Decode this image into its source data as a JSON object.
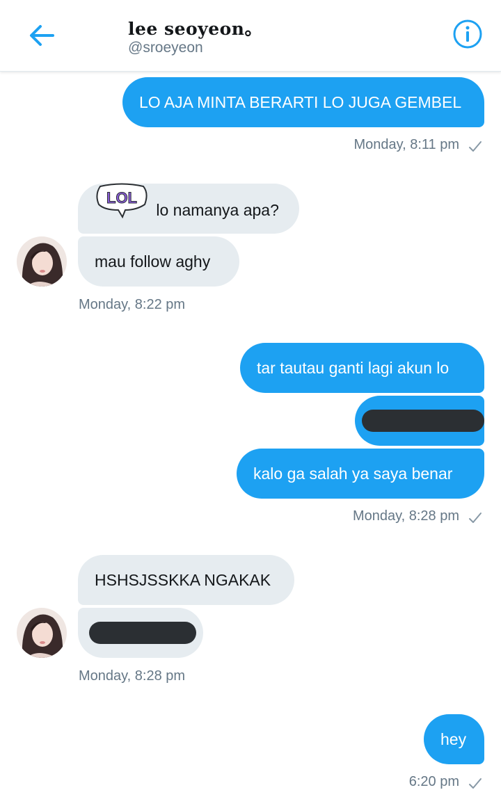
{
  "header": {
    "title": "lee seoyeon。",
    "handle": "@sroeyeon"
  },
  "icons": {
    "back": "arrow-left-icon",
    "info": "info-circle-icon",
    "check": "checkmark-icon",
    "sticker": "lol-sticker-icon"
  },
  "colors": {
    "accent": "#1da1f2",
    "incoming_bubble": "#e6ecf0",
    "meta_text": "#657786"
  },
  "messages": {
    "m1": "LO AJA MINTA BERARTI LO JUGA GEMBEL",
    "m1_time": "Monday, 8:11 pm",
    "m2_sticker": "LOL",
    "m2": "lo namanya apa?",
    "m3": "mau follow aghy",
    "m3_time": "Monday, 8:22 pm",
    "m4": "tar tautau ganti lagi akun lo",
    "m6": "kalo ga salah ya saya benar",
    "m6_time": "Monday, 8:28 pm",
    "m7": "HSHSJSSKKA NGAKAK",
    "m8_time": "Monday, 8:28 pm",
    "m9": "hey",
    "m9_time": "6:20 pm"
  }
}
